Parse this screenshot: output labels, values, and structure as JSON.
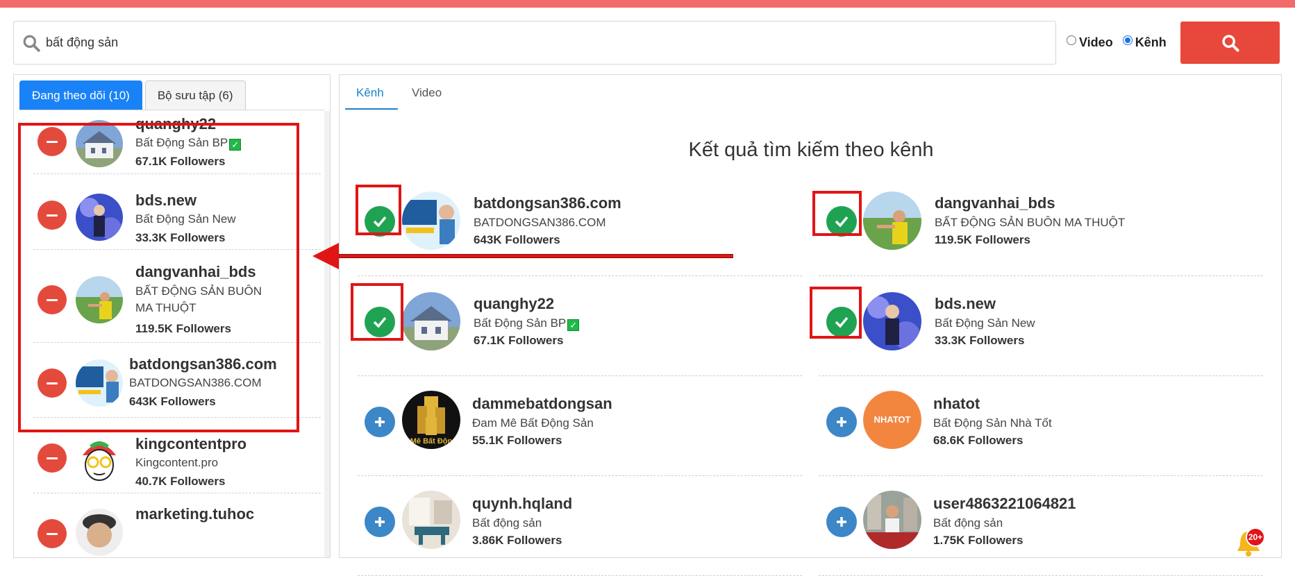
{
  "search": {
    "value": "bất động sản",
    "options": [
      "Video",
      "Kênh"
    ],
    "selected": "Kênh"
  },
  "left": {
    "tabs": [
      {
        "label": "Đang theo dõi (10)",
        "active": true
      },
      {
        "label": "Bộ sưu tập (6)",
        "active": false
      }
    ],
    "items": [
      {
        "name": "quanghy22",
        "desc": "Bất Động Sản BP",
        "verified": true,
        "followers": "67.1K Followers"
      },
      {
        "name": "bds.new",
        "desc": "Bất Động Sản New",
        "followers": "33.3K Followers"
      },
      {
        "name": "dangvanhai_bds",
        "desc": "BẤT ĐỘNG SẢN BUÔN MA THUỘT",
        "followers": "119.5K Followers"
      },
      {
        "name": "batdongsan386.com",
        "desc": "BATDONGSAN386.COM",
        "followers": "643K Followers"
      },
      {
        "name": "kingcontentpro",
        "desc": "Kingcontent.pro",
        "followers": "40.7K Followers"
      },
      {
        "name": "marketing.tuhoc",
        "desc": "",
        "followers": ""
      }
    ]
  },
  "right": {
    "tabs": [
      "Kênh",
      "Video"
    ],
    "title": "Kết quả tìm kiếm theo kênh",
    "results": [
      {
        "name": "batdongsan386.com",
        "desc": "BATDONGSAN386.COM",
        "followers": "643K Followers",
        "followed": true
      },
      {
        "name": "dangvanhai_bds",
        "desc": "BẤT ĐỘNG SẢN BUÔN MA THUỘT",
        "followers": "119.5K Followers",
        "followed": true
      },
      {
        "name": "quanghy22",
        "desc": "Bất Động Sản BP",
        "verified": true,
        "followers": "67.1K Followers",
        "followed": true
      },
      {
        "name": "bds.new",
        "desc": "Bất Động Sản New",
        "followers": "33.3K Followers",
        "followed": true
      },
      {
        "name": "dammebatdongsan",
        "desc": "Đam Mê Bất Động Sản",
        "followers": "55.1K Followers",
        "followed": false
      },
      {
        "name": "nhatot",
        "desc": "Bất Động Sản Nhà Tốt",
        "followers": "68.6K Followers",
        "followed": false
      },
      {
        "name": "quynh.hqland",
        "desc": "Bất động sản",
        "followers": "3.86K Followers",
        "followed": false
      },
      {
        "name": "user4863221064821",
        "desc": "Bất động sản",
        "followers": "1.75K Followers",
        "followed": false
      }
    ]
  },
  "avatar_text": {
    "damme": "Mê Bất Độn",
    "nhatot": "NHATOT"
  },
  "notification": {
    "badge": "20+"
  },
  "colors": {
    "primary": "#1a82f7",
    "danger": "#e8473b",
    "success": "#1fa353",
    "info": "#3c87c7",
    "highlight": "#e01515"
  }
}
